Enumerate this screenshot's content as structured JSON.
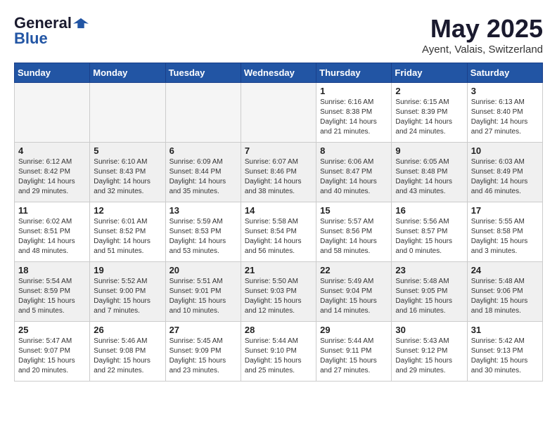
{
  "header": {
    "logo_general": "General",
    "logo_blue": "Blue",
    "month": "May 2025",
    "location": "Ayent, Valais, Switzerland"
  },
  "weekdays": [
    "Sunday",
    "Monday",
    "Tuesday",
    "Wednesday",
    "Thursday",
    "Friday",
    "Saturday"
  ],
  "weeks": [
    [
      {
        "day": "",
        "info": ""
      },
      {
        "day": "",
        "info": ""
      },
      {
        "day": "",
        "info": ""
      },
      {
        "day": "",
        "info": ""
      },
      {
        "day": "1",
        "info": "Sunrise: 6:16 AM\nSunset: 8:38 PM\nDaylight: 14 hours\nand 21 minutes."
      },
      {
        "day": "2",
        "info": "Sunrise: 6:15 AM\nSunset: 8:39 PM\nDaylight: 14 hours\nand 24 minutes."
      },
      {
        "day": "3",
        "info": "Sunrise: 6:13 AM\nSunset: 8:40 PM\nDaylight: 14 hours\nand 27 minutes."
      }
    ],
    [
      {
        "day": "4",
        "info": "Sunrise: 6:12 AM\nSunset: 8:42 PM\nDaylight: 14 hours\nand 29 minutes."
      },
      {
        "day": "5",
        "info": "Sunrise: 6:10 AM\nSunset: 8:43 PM\nDaylight: 14 hours\nand 32 minutes."
      },
      {
        "day": "6",
        "info": "Sunrise: 6:09 AM\nSunset: 8:44 PM\nDaylight: 14 hours\nand 35 minutes."
      },
      {
        "day": "7",
        "info": "Sunrise: 6:07 AM\nSunset: 8:46 PM\nDaylight: 14 hours\nand 38 minutes."
      },
      {
        "day": "8",
        "info": "Sunrise: 6:06 AM\nSunset: 8:47 PM\nDaylight: 14 hours\nand 40 minutes."
      },
      {
        "day": "9",
        "info": "Sunrise: 6:05 AM\nSunset: 8:48 PM\nDaylight: 14 hours\nand 43 minutes."
      },
      {
        "day": "10",
        "info": "Sunrise: 6:03 AM\nSunset: 8:49 PM\nDaylight: 14 hours\nand 46 minutes."
      }
    ],
    [
      {
        "day": "11",
        "info": "Sunrise: 6:02 AM\nSunset: 8:51 PM\nDaylight: 14 hours\nand 48 minutes."
      },
      {
        "day": "12",
        "info": "Sunrise: 6:01 AM\nSunset: 8:52 PM\nDaylight: 14 hours\nand 51 minutes."
      },
      {
        "day": "13",
        "info": "Sunrise: 5:59 AM\nSunset: 8:53 PM\nDaylight: 14 hours\nand 53 minutes."
      },
      {
        "day": "14",
        "info": "Sunrise: 5:58 AM\nSunset: 8:54 PM\nDaylight: 14 hours\nand 56 minutes."
      },
      {
        "day": "15",
        "info": "Sunrise: 5:57 AM\nSunset: 8:56 PM\nDaylight: 14 hours\nand 58 minutes."
      },
      {
        "day": "16",
        "info": "Sunrise: 5:56 AM\nSunset: 8:57 PM\nDaylight: 15 hours\nand 0 minutes."
      },
      {
        "day": "17",
        "info": "Sunrise: 5:55 AM\nSunset: 8:58 PM\nDaylight: 15 hours\nand 3 minutes."
      }
    ],
    [
      {
        "day": "18",
        "info": "Sunrise: 5:54 AM\nSunset: 8:59 PM\nDaylight: 15 hours\nand 5 minutes."
      },
      {
        "day": "19",
        "info": "Sunrise: 5:52 AM\nSunset: 9:00 PM\nDaylight: 15 hours\nand 7 minutes."
      },
      {
        "day": "20",
        "info": "Sunrise: 5:51 AM\nSunset: 9:01 PM\nDaylight: 15 hours\nand 10 minutes."
      },
      {
        "day": "21",
        "info": "Sunrise: 5:50 AM\nSunset: 9:03 PM\nDaylight: 15 hours\nand 12 minutes."
      },
      {
        "day": "22",
        "info": "Sunrise: 5:49 AM\nSunset: 9:04 PM\nDaylight: 15 hours\nand 14 minutes."
      },
      {
        "day": "23",
        "info": "Sunrise: 5:48 AM\nSunset: 9:05 PM\nDaylight: 15 hours\nand 16 minutes."
      },
      {
        "day": "24",
        "info": "Sunrise: 5:48 AM\nSunset: 9:06 PM\nDaylight: 15 hours\nand 18 minutes."
      }
    ],
    [
      {
        "day": "25",
        "info": "Sunrise: 5:47 AM\nSunset: 9:07 PM\nDaylight: 15 hours\nand 20 minutes."
      },
      {
        "day": "26",
        "info": "Sunrise: 5:46 AM\nSunset: 9:08 PM\nDaylight: 15 hours\nand 22 minutes."
      },
      {
        "day": "27",
        "info": "Sunrise: 5:45 AM\nSunset: 9:09 PM\nDaylight: 15 hours\nand 23 minutes."
      },
      {
        "day": "28",
        "info": "Sunrise: 5:44 AM\nSunset: 9:10 PM\nDaylight: 15 hours\nand 25 minutes."
      },
      {
        "day": "29",
        "info": "Sunrise: 5:44 AM\nSunset: 9:11 PM\nDaylight: 15 hours\nand 27 minutes."
      },
      {
        "day": "30",
        "info": "Sunrise: 5:43 AM\nSunset: 9:12 PM\nDaylight: 15 hours\nand 29 minutes."
      },
      {
        "day": "31",
        "info": "Sunrise: 5:42 AM\nSunset: 9:13 PM\nDaylight: 15 hours\nand 30 minutes."
      }
    ]
  ]
}
